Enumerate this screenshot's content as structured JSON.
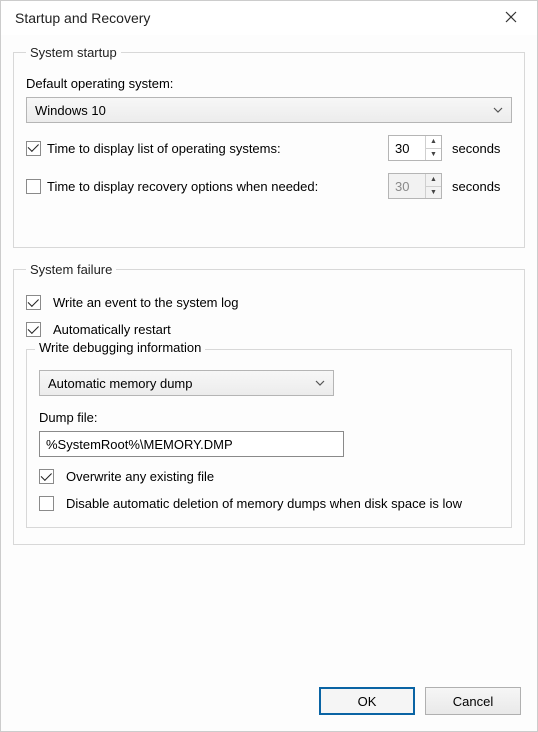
{
  "title": "Startup and Recovery",
  "system_startup": {
    "legend": "System startup",
    "default_os_label": "Default operating system:",
    "default_os_value": "Windows 10",
    "display_list": {
      "label": "Time to display list of operating systems:",
      "checked": true,
      "value": "30",
      "unit": "seconds"
    },
    "display_recovery": {
      "label": "Time to display recovery options when needed:",
      "checked": false,
      "value": "30",
      "unit": "seconds"
    }
  },
  "system_failure": {
    "legend": "System failure",
    "write_event": {
      "label": "Write an event to the system log",
      "checked": true
    },
    "auto_restart": {
      "label": "Automatically restart",
      "checked": true
    },
    "debug_group": {
      "legend": "Write debugging information",
      "dump_type": "Automatic memory dump",
      "dump_file_label": "Dump file:",
      "dump_file_value": "%SystemRoot%\\MEMORY.DMP",
      "overwrite": {
        "label": "Overwrite any existing file",
        "checked": true
      },
      "disable_deletion": {
        "label": "Disable automatic deletion of memory dumps when disk space is low",
        "checked": false
      }
    }
  },
  "buttons": {
    "ok": "OK",
    "cancel": "Cancel"
  }
}
